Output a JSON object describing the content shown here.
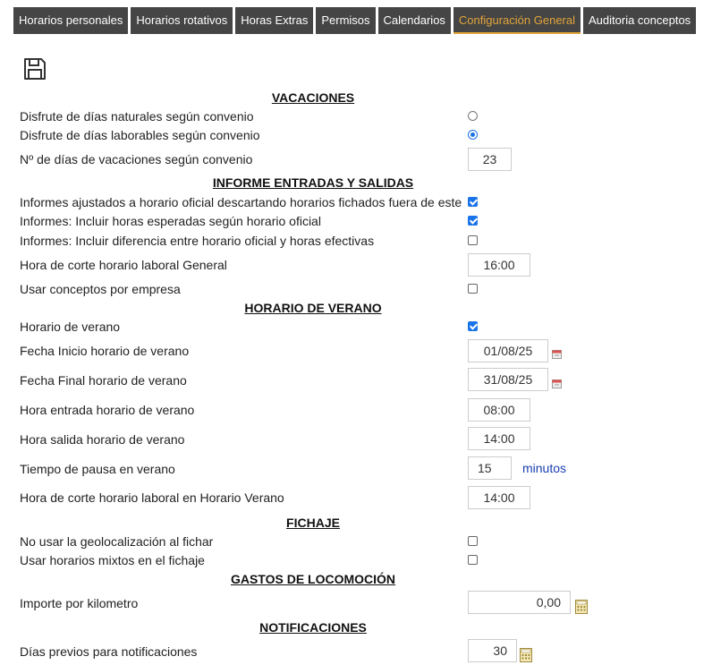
{
  "tabs": [
    {
      "label": "Horarios personales",
      "active": false
    },
    {
      "label": "Horarios rotativos",
      "active": false
    },
    {
      "label": "Horas Extras",
      "active": false
    },
    {
      "label": "Permisos",
      "active": false
    },
    {
      "label": "Calendarios",
      "active": false
    },
    {
      "label": "Configuración General",
      "active": true
    },
    {
      "label": "Auditoria conceptos",
      "active": false
    }
  ],
  "colors": {
    "tab_bg": "#454545",
    "tab_active_text": "#e2a43a",
    "accent": "#1a73e8",
    "unit_text": "#1a3fb0"
  },
  "icons": {
    "save": "floppy-disk-icon",
    "calendar": "calendar-icon",
    "calculator": "calculator-icon"
  },
  "sections": {
    "vacaciones": "VACACIONES",
    "informe": "INFORME ENTRADAS Y SALIDAS",
    "verano": "HORARIO DE VERANO",
    "fichaje": "FICHAJE",
    "gastos": "GASTOS DE LOCOMOCIÓN",
    "notificaciones": "NOTIFICACIONES"
  },
  "vacaciones": {
    "naturales_label": "Disfrute de días naturales según convenio",
    "naturales_selected": false,
    "laborables_label": "Disfrute de días laborables según convenio",
    "laborables_selected": true,
    "dias_label": "Nº de días de vacaciones según convenio",
    "dias_value": "23"
  },
  "informe": {
    "ajustados_label": "Informes ajustados a horario oficial descartando horarios fichados fuera de este",
    "ajustados_checked": true,
    "esperadas_label": "Informes: Incluir horas esperadas según horario oficial",
    "esperadas_checked": true,
    "diferencia_label": "Informes: Incluir diferencia entre horario oficial y horas efectivas",
    "diferencia_checked": false,
    "corte_label": "Hora de corte horario laboral General",
    "corte_value": "16:00",
    "conceptos_label": "Usar conceptos por empresa",
    "conceptos_checked": false
  },
  "verano": {
    "horario_label": "Horario de verano",
    "horario_checked": true,
    "inicio_label": "Fecha Inicio horario de verano",
    "inicio_value": "01/08/25",
    "final_label": "Fecha Final horario de verano",
    "final_value": "31/08/25",
    "entrada_label": "Hora entrada horario de verano",
    "entrada_value": "08:00",
    "salida_label": "Hora salida horario de verano",
    "salida_value": "14:00",
    "pausa_label": "Tiempo de pausa en verano",
    "pausa_value": "15",
    "pausa_unit": "minutos",
    "corte_label": "Hora de corte horario laboral en Horario Verano",
    "corte_value": "14:00"
  },
  "fichaje": {
    "geo_label": "No usar la geolocalización al fichar",
    "geo_checked": false,
    "mixtos_label": "Usar horarios mixtos en el fichaje",
    "mixtos_checked": false
  },
  "gastos": {
    "km_label": "Importe por kilometro",
    "km_value": "0,00"
  },
  "notificaciones": {
    "dias_label": "Días previos para notificaciones",
    "dias_value": "30"
  }
}
